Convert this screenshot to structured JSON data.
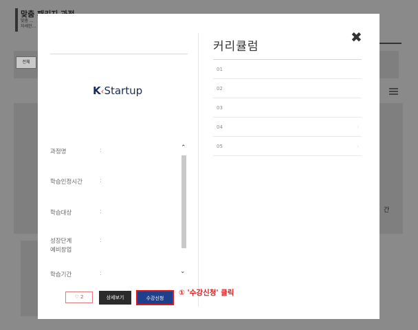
{
  "background": {
    "title": "맞춤 패키지 과정",
    "subtitle_lines": [
      "맞춤 ...",
      "자세한..."
    ],
    "tab_label": "전체",
    "right_text": "간"
  },
  "modal": {
    "logo": {
      "k": "K",
      "rest": "Startup",
      "accent_color": "#e0402e",
      "brand_color": "#1a2a57"
    },
    "info_rows": [
      {
        "label": "과정명",
        "colon": ":"
      },
      {
        "label": "학습인정시간",
        "colon": ":"
      },
      {
        "label": "학습대상",
        "colon": ":"
      },
      {
        "label": "성장단계\n예비창업",
        "colon": ":"
      },
      {
        "label": "학습기간",
        "colon": ":"
      }
    ],
    "curriculum_title": "커리큘럼",
    "close_icon": "✖",
    "curriculum_items": [
      "01",
      "02",
      "03",
      "04",
      "05"
    ],
    "buttons": {
      "like_icon": "♡",
      "like_count": "2",
      "detail_label": "상세보기",
      "apply_label": "수강신청"
    },
    "annotation": "① '수강신청' 클릭"
  }
}
